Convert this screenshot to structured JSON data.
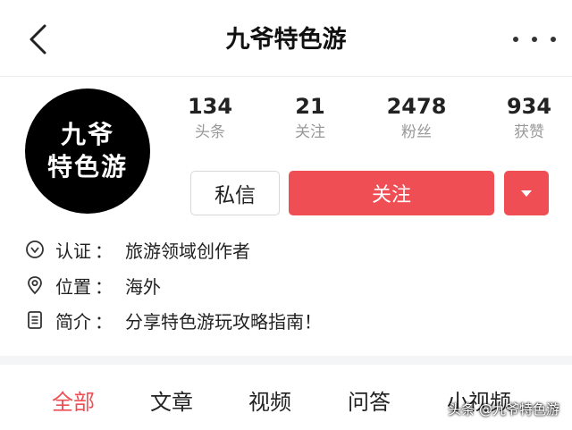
{
  "header": {
    "title": "九爷特色游"
  },
  "profile": {
    "avatar_line1": "九爷",
    "avatar_line2": "特色游"
  },
  "stats": [
    {
      "value": "134",
      "label": "头条"
    },
    {
      "value": "21",
      "label": "关注"
    },
    {
      "value": "2478",
      "label": "粉丝"
    },
    {
      "value": "934",
      "label": "获赞"
    }
  ],
  "actions": {
    "message_label": "私信",
    "follow_label": "关注"
  },
  "info": {
    "certification": {
      "label": "认证",
      "sep": "：",
      "value": "旅游领域创作者"
    },
    "location": {
      "label": "位置",
      "sep": "：",
      "value": "海外"
    },
    "intro": {
      "label": "简介",
      "sep": "：",
      "value": "分享特色游玩攻略指南！"
    }
  },
  "tabs": [
    {
      "label": "全部",
      "active": true
    },
    {
      "label": "文章",
      "active": false
    },
    {
      "label": "视频",
      "active": false
    },
    {
      "label": "问答",
      "active": false
    },
    {
      "label": "小视频",
      "active": false
    }
  ],
  "watermark": "头条 @九爷特色游",
  "colors": {
    "accent": "#f04e55",
    "muted_text": "#999999"
  }
}
